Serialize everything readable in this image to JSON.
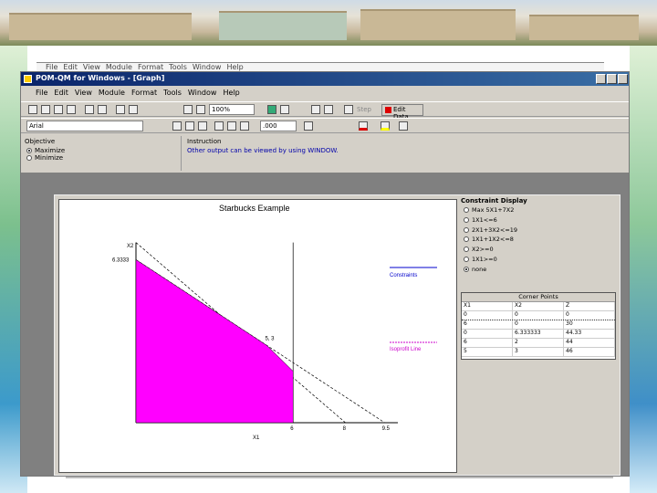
{
  "ghost_menu": [
    "File",
    "Edit",
    "View",
    "Module",
    "Format",
    "Tools",
    "Window",
    "Help"
  ],
  "window": {
    "title": "POM-QM for Windows - [Graph]"
  },
  "menu": [
    "File",
    "Edit",
    "View",
    "Module",
    "Format",
    "Tools",
    "Window",
    "Help"
  ],
  "toolbar": {
    "zoom": "100%",
    "step_label": "Step",
    "edit_data_label": "Edit Data",
    "font_name": "Arial",
    "number_format": ".000"
  },
  "objective": {
    "label": "Objective",
    "options": [
      {
        "label": "Maximize",
        "selected": true
      },
      {
        "label": "Minimize",
        "selected": false
      }
    ]
  },
  "instruction": {
    "label": "Instruction",
    "text": "Other output can be viewed by using WINDOW."
  },
  "graph": {
    "title": "Starbucks Example",
    "x_axis_label": "X1",
    "y_axis_label": "X2",
    "y_tick": "6.3333",
    "x_ticks": [
      "6",
      "8",
      "9.5"
    ],
    "point_label": "5, 3",
    "legend_constraints": "Constraints",
    "legend_isoprofit": "Isoprofit Line",
    "colors": {
      "feasible": "#ff00ff",
      "constraint": "#0000cc",
      "isoprofit": "#cc00cc"
    }
  },
  "chart_data": {
    "type": "line",
    "title": "Starbucks Example",
    "xlabel": "X1",
    "ylabel": "X2",
    "xlim": [
      0,
      10
    ],
    "ylim": [
      0,
      7
    ],
    "feasible_region": [
      [
        0,
        0
      ],
      [
        0,
        6.3333
      ],
      [
        5,
        3
      ],
      [
        6,
        2
      ],
      [
        6,
        0
      ]
    ],
    "series": [
      {
        "x": [
          0,
          8
        ],
        "y": [
          7,
          0
        ]
      },
      {
        "x": [
          0,
          9.5
        ],
        "y": [
          6.3333,
          0
        ]
      },
      {
        "x": [
          6,
          6
        ],
        "y": [
          0,
          7
        ]
      }
    ]
  },
  "constraint_display": {
    "title": "Constraint Display",
    "options": [
      {
        "label": "Max 5X1+7X2",
        "selected": false
      },
      {
        "label": "1X1<=6",
        "selected": false
      },
      {
        "label": "2X1+3X2<=19",
        "selected": false
      },
      {
        "label": "1X1+1X2<=8",
        "selected": false
      },
      {
        "label": "X2>=0",
        "selected": false
      },
      {
        "label": "1X1>=0",
        "selected": false
      },
      {
        "label": "none",
        "selected": true
      }
    ]
  },
  "corner_points": {
    "title": "Corner Points",
    "headers": [
      "X1",
      "X2",
      "Z"
    ],
    "rows": [
      [
        "0",
        "0",
        "0"
      ],
      [
        "6",
        "0",
        "30"
      ],
      [
        "0",
        "6.333333",
        "44.33"
      ],
      [
        "6",
        "2",
        "44"
      ],
      [
        "5",
        "3",
        "46"
      ]
    ]
  }
}
